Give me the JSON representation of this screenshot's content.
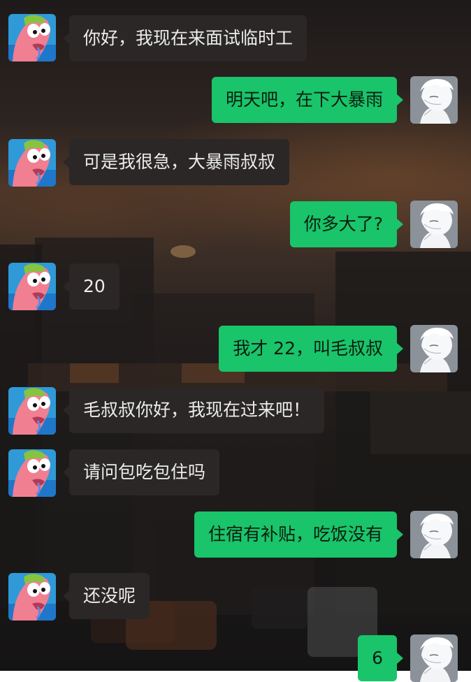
{
  "messages": [
    {
      "side": "left",
      "avatar": "patrick-avatar",
      "text": "你好，我现在来面试临时工"
    },
    {
      "side": "right",
      "avatar": "boy-avatar",
      "text": "明天吧，在下大暴雨"
    },
    {
      "side": "left",
      "avatar": "patrick-avatar",
      "text": "可是我很急，大暴雨叔叔"
    },
    {
      "side": "right",
      "avatar": "boy-avatar",
      "text": "你多大了?"
    },
    {
      "side": "left",
      "avatar": "patrick-avatar",
      "text": "20"
    },
    {
      "side": "right",
      "avatar": "boy-avatar",
      "text": "我才 22，叫毛叔叔"
    },
    {
      "side": "left",
      "avatar": "patrick-avatar",
      "text": "毛叔叔你好，我现在过来吧！"
    },
    {
      "side": "left",
      "avatar": "patrick-avatar",
      "text": "请问包吃包住吗"
    },
    {
      "side": "right",
      "avatar": "boy-avatar",
      "text": "住宿有补贴，吃饭没有"
    },
    {
      "side": "left",
      "avatar": "patrick-avatar",
      "text": "还没呢"
    },
    {
      "side": "right",
      "avatar": "boy-avatar",
      "text": "6"
    }
  ],
  "colors": {
    "sent_bubble": "#19c46a",
    "received_bubble": "#2a2726",
    "sent_text": "#0c1d10",
    "received_text": "#ececec"
  }
}
